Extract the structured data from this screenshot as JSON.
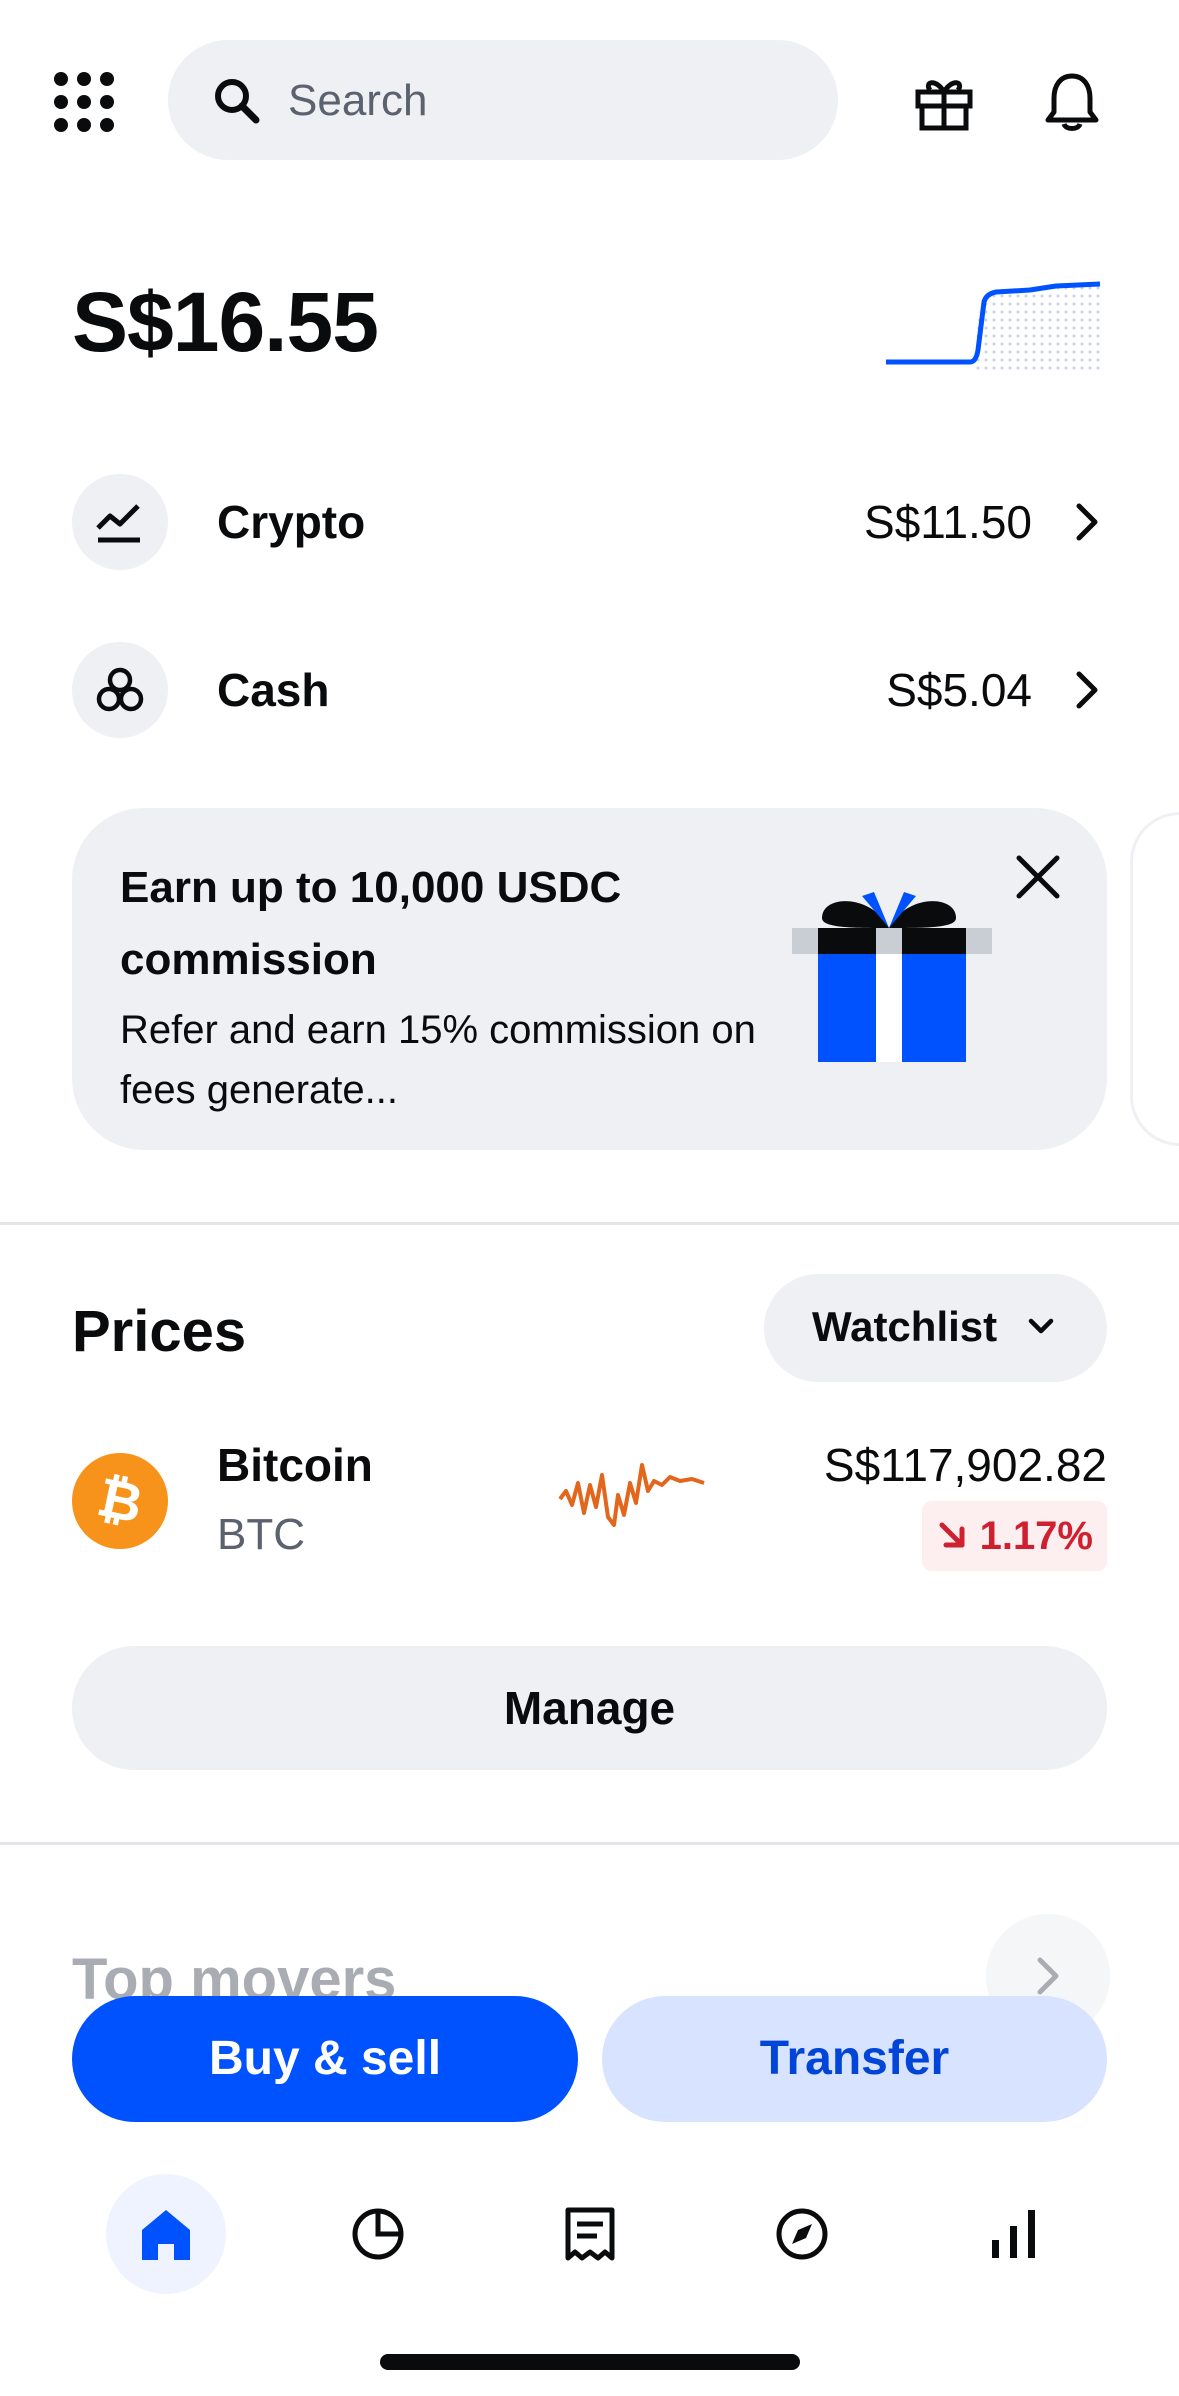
{
  "header": {
    "search_placeholder": "Search",
    "icons": [
      "apps-grid-icon",
      "search-icon",
      "gift-icon",
      "bell-icon"
    ]
  },
  "balance": {
    "total": "S$16.55"
  },
  "assets": [
    {
      "name": "Crypto",
      "value": "S$11.50",
      "icon": "chart-trend-icon"
    },
    {
      "name": "Cash",
      "value": "S$5.04",
      "icon": "coins-icon"
    }
  ],
  "promo": {
    "title": "Earn up to 10,000 USDC commission",
    "description": "Refer and earn 15% commission on fees generate..."
  },
  "prices": {
    "title": "Prices",
    "filter_label": "Watchlist",
    "coins": [
      {
        "name": "Bitcoin",
        "ticker": "BTC",
        "price": "S$117,902.82",
        "change": "1.17%",
        "direction": "down"
      }
    ],
    "manage_label": "Manage"
  },
  "top_movers": {
    "title": "Top movers"
  },
  "actions": {
    "buy_sell_label": "Buy & sell",
    "transfer_label": "Transfer"
  },
  "nav": {
    "items": [
      "home-icon",
      "portfolio-icon",
      "transactions-icon",
      "explore-icon",
      "markets-icon"
    ],
    "active": "home-icon"
  },
  "colors": {
    "brand_blue": "#0052ff",
    "light_blue": "#d8e4ff",
    "surface_gray": "#eef0f3",
    "negative_red": "#cf202f",
    "bitcoin_orange": "#f7931a"
  }
}
